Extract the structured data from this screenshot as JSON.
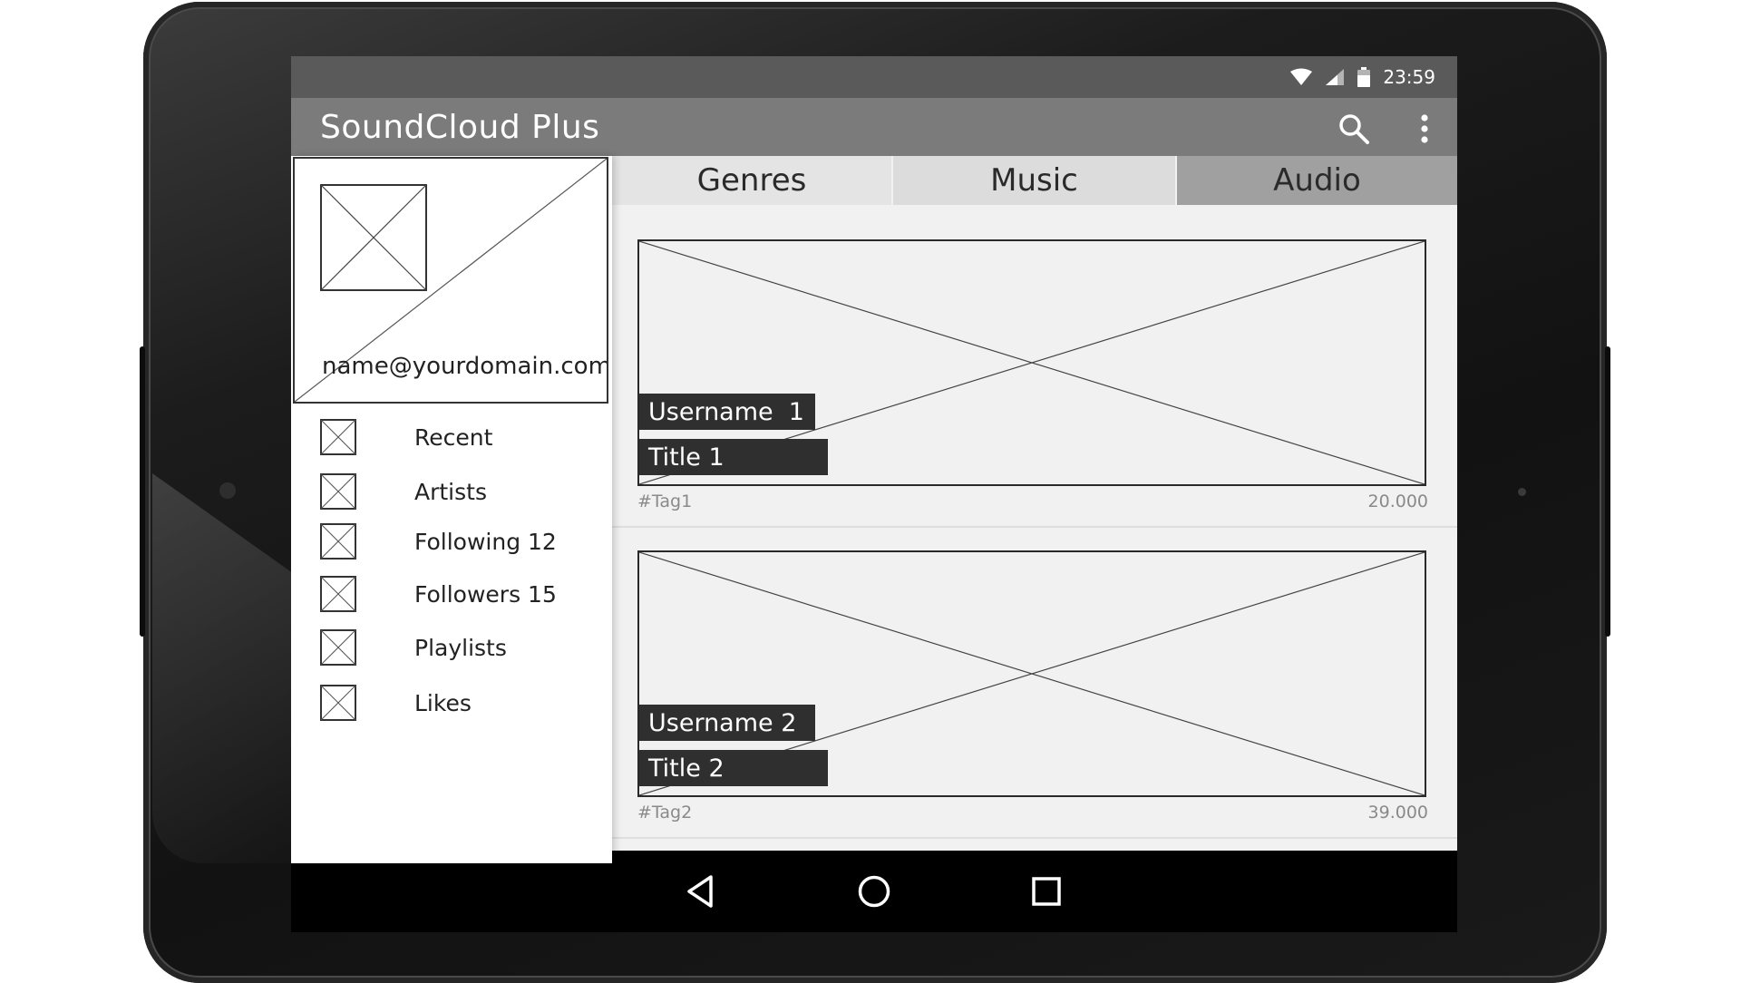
{
  "status_bar": {
    "time": "23:59",
    "icons": [
      "wifi-icon",
      "cell-signal-icon",
      "battery-icon"
    ]
  },
  "app_bar": {
    "title": "SoundCloud Plus",
    "actions": [
      "search-icon",
      "more-vert-icon"
    ]
  },
  "drawer": {
    "email": "name@yourdomain.com",
    "items": [
      {
        "label": "Recent"
      },
      {
        "label": "Artists"
      },
      {
        "label": "Following 12"
      },
      {
        "label": "Followers 15"
      },
      {
        "label": "Playlists"
      },
      {
        "label": "Likes"
      }
    ]
  },
  "tabs": [
    {
      "label": "Genres"
    },
    {
      "label": "Music"
    },
    {
      "label": "Audio",
      "selected": true
    }
  ],
  "cards": [
    {
      "username": "Username  1",
      "title": "Title 1",
      "tag": "#Tag1",
      "count": "20.000"
    },
    {
      "username": "Username 2",
      "title": "Title 2",
      "tag": "#Tag2",
      "count": "39.000"
    }
  ],
  "nav_bar": {
    "buttons": [
      "back-icon",
      "home-icon",
      "recents-icon"
    ]
  },
  "colors": {
    "status_bar": "#5a5a5a",
    "app_bar": "#7b7b7b",
    "selected_tab": "#a0a0a0",
    "chip": "#2f2f2f"
  }
}
